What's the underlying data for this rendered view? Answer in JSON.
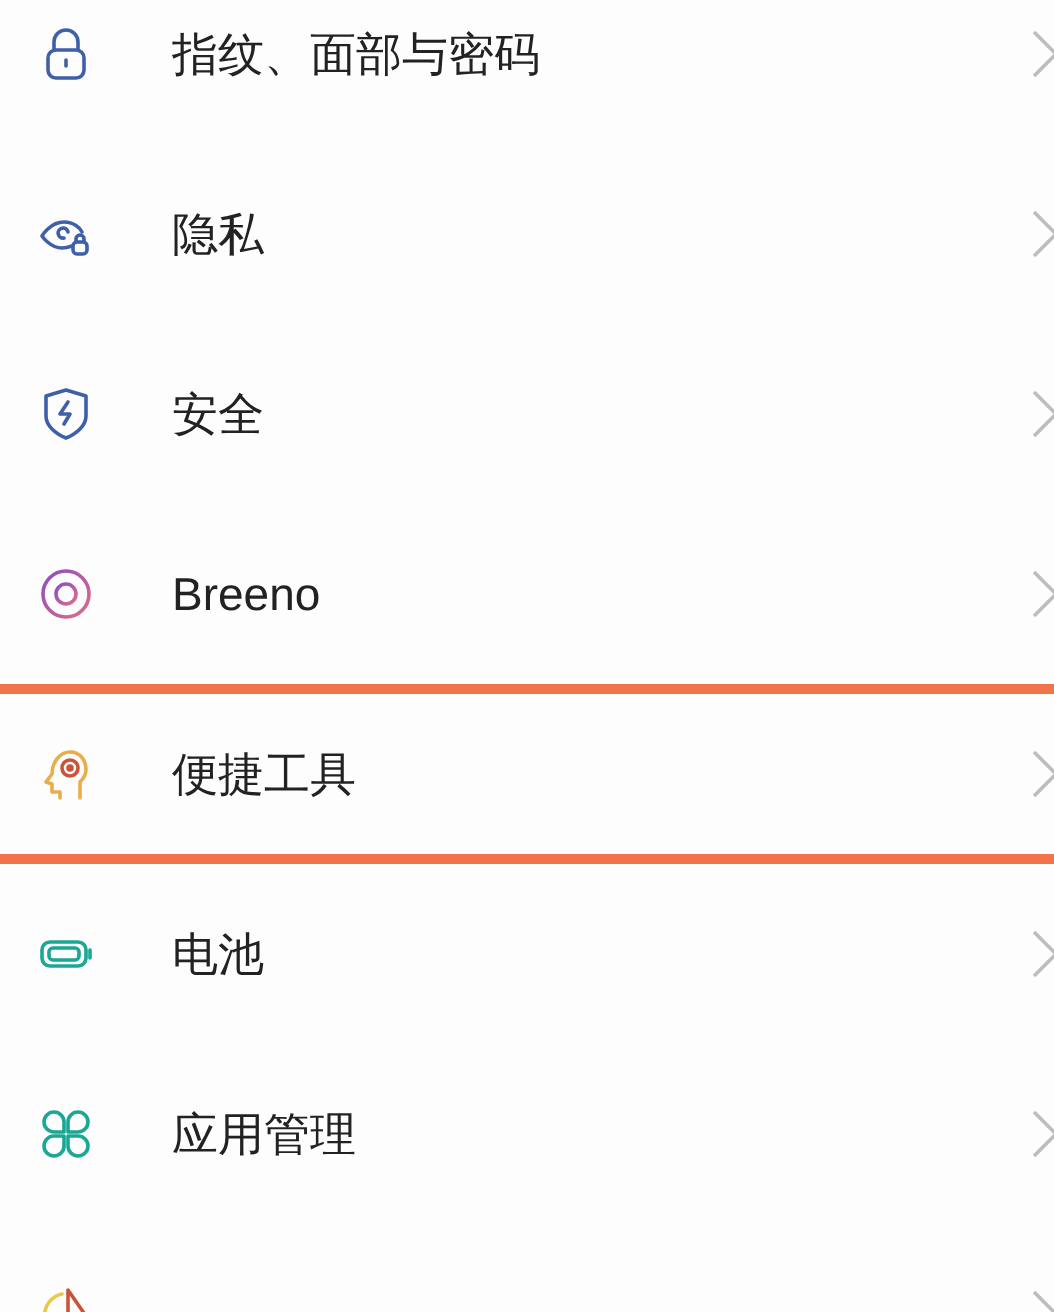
{
  "settings_items": [
    {
      "label": "指纹、面部与密码",
      "highlighted": false
    },
    {
      "label": "隐私",
      "highlighted": false
    },
    {
      "label": "安全",
      "highlighted": false
    },
    {
      "label": "Breeno",
      "highlighted": false
    },
    {
      "label": "便捷工具",
      "highlighted": true
    },
    {
      "label": "电池",
      "highlighted": false
    },
    {
      "label": "应用管理",
      "highlighted": false
    },
    {
      "highlighted": false
    }
  ]
}
